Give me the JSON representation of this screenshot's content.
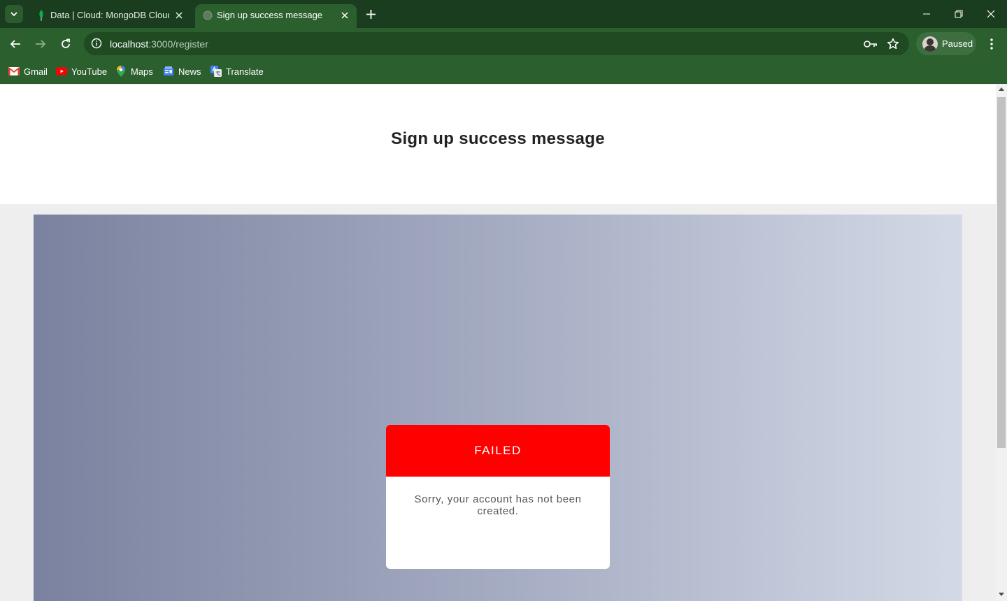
{
  "browser": {
    "tabs": [
      {
        "title": "Data | Cloud: MongoDB Cloud",
        "favicon": "mongodb-leaf-icon",
        "active": false
      },
      {
        "title": "Sign up success message",
        "favicon": "globe-icon",
        "active": true
      }
    ],
    "address": {
      "host": "localhost",
      "path": ":3000/register"
    },
    "profile_label": "Paused",
    "bookmarks": [
      {
        "label": "Gmail",
        "icon": "gmail-icon"
      },
      {
        "label": "YouTube",
        "icon": "youtube-icon"
      },
      {
        "label": "Maps",
        "icon": "maps-icon"
      },
      {
        "label": "News",
        "icon": "news-icon"
      },
      {
        "label": "Translate",
        "icon": "translate-icon"
      }
    ],
    "colors": {
      "frame": "#1b3d1f",
      "toolbar": "#2c5f2e"
    }
  },
  "page": {
    "title": "Sign up success message",
    "card": {
      "status": "FAILED",
      "message": "Sorry, your account has not been created.",
      "status_color": "#ff0000"
    }
  }
}
